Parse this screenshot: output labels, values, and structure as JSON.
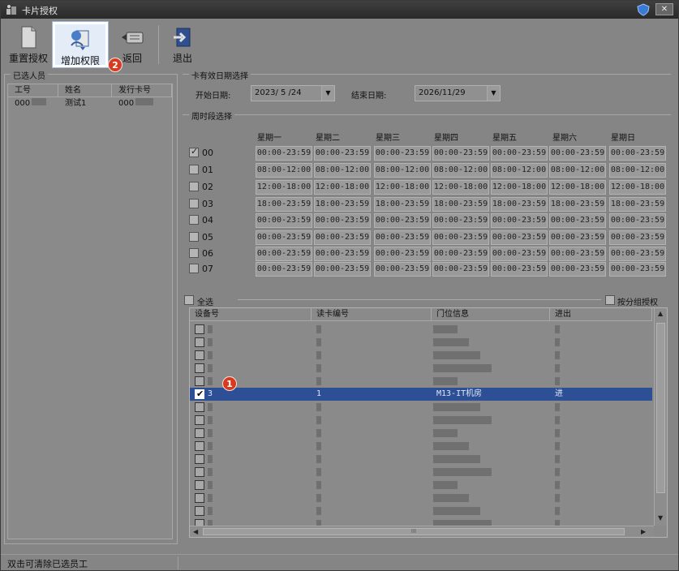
{
  "window": {
    "title": "卡片授权"
  },
  "toolbar": {
    "reset_label": "重置授权",
    "add_label": "增加权限",
    "back_label": "返回",
    "exit_label": "退出"
  },
  "markers": {
    "m1": "1",
    "m2": "2"
  },
  "selected_people": {
    "title": "已选人员",
    "columns": [
      "工号",
      "姓名",
      "发行卡号"
    ],
    "rows": [
      {
        "id": "000",
        "name": "测试1",
        "card": "000"
      }
    ]
  },
  "validity": {
    "title": "卡有效日期选择",
    "start_label": "开始日期:",
    "start_value": "2023/ 5 /24",
    "end_label": "结束日期:",
    "end_value": "2026/11/29"
  },
  "week": {
    "title": "周时段选择",
    "days": [
      "星期一",
      "星期二",
      "星期三",
      "星期四",
      "星期五",
      "星期六",
      "星期日"
    ],
    "rows": [
      {
        "code": "00",
        "checked": true,
        "slot": "00:00-23:59"
      },
      {
        "code": "01",
        "checked": false,
        "slot": "08:00-12:00"
      },
      {
        "code": "02",
        "checked": false,
        "slot": "12:00-18:00"
      },
      {
        "code": "03",
        "checked": false,
        "slot": "18:00-23:59"
      },
      {
        "code": "04",
        "checked": false,
        "slot": "00:00-23:59"
      },
      {
        "code": "05",
        "checked": false,
        "slot": "00:00-23:59"
      },
      {
        "code": "06",
        "checked": false,
        "slot": "00:00-23:59"
      },
      {
        "code": "07",
        "checked": false,
        "slot": "00:00-23:59"
      }
    ]
  },
  "devices": {
    "select_all_label": "全选",
    "group_auth_label": "按分组授权",
    "columns": [
      "设备号",
      "读卡编号",
      "门位信息",
      "进出"
    ],
    "selected_row": {
      "device": "3",
      "reader": "1",
      "door": "M13-IT机房",
      "direction": "进"
    },
    "scroll_grip": "III"
  },
  "status": {
    "hint": "双击可清除已选员工"
  }
}
